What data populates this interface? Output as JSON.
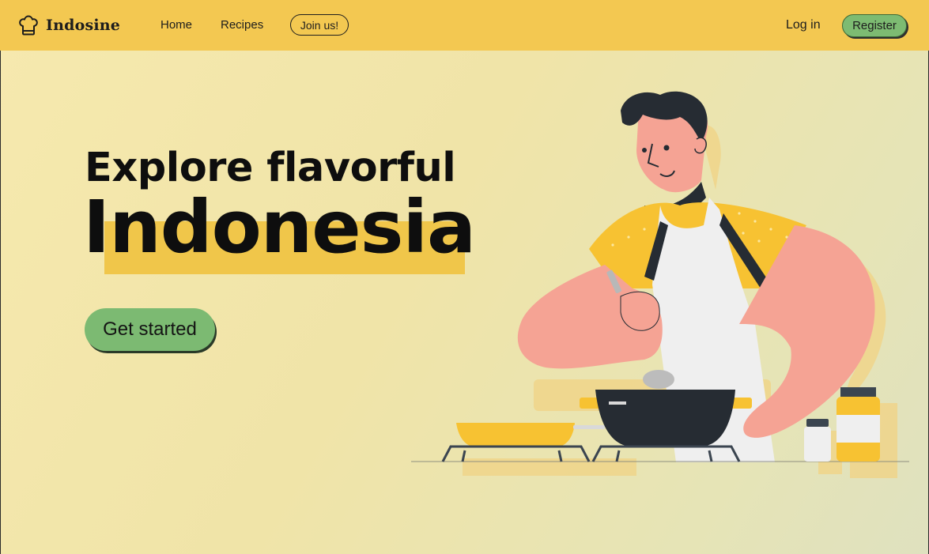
{
  "brand": {
    "name": "Indosine",
    "logo_icon": "chef-hat-icon"
  },
  "nav": {
    "home": "Home",
    "recipes": "Recipes",
    "join": "Join us!"
  },
  "auth": {
    "login": "Log in",
    "register": "Register"
  },
  "hero": {
    "line1": "Explore flavorful",
    "line2": "Indonesia",
    "cta": "Get started"
  },
  "colors": {
    "header": "#f3c851",
    "accent_yellow": "#f0c64a",
    "button_green": "#7cba72",
    "text": "#0e0e0e"
  },
  "illustration": {
    "subject": "chef-cooking-illustration"
  }
}
